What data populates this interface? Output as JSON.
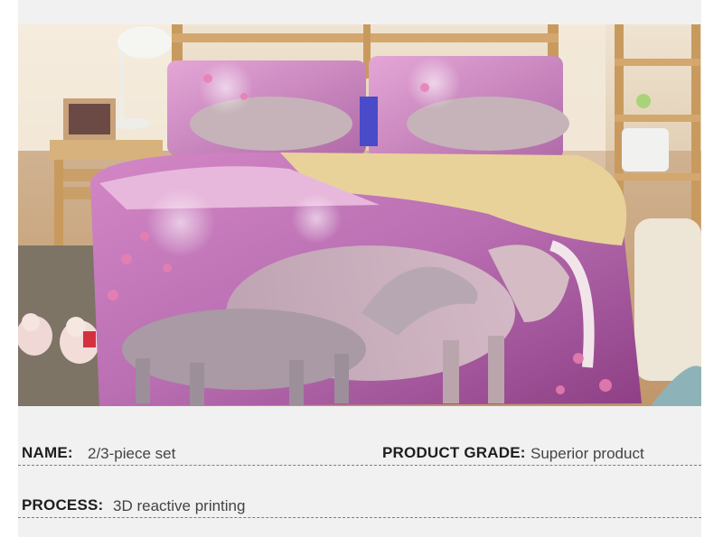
{
  "product_photo": {
    "subject": "unicorn-bedding-set",
    "colors": {
      "primary": "#c77bbf",
      "accent": "#e9d29a",
      "wood": "#c99a5e"
    }
  },
  "specs": {
    "name": {
      "label": "NAME:",
      "value": "2/3-piece set"
    },
    "product_grade": {
      "label": "PRODUCT GRADE:",
      "value": "Superior product"
    },
    "process": {
      "label": "PROCESS:",
      "value": "3D reactive printing"
    }
  }
}
